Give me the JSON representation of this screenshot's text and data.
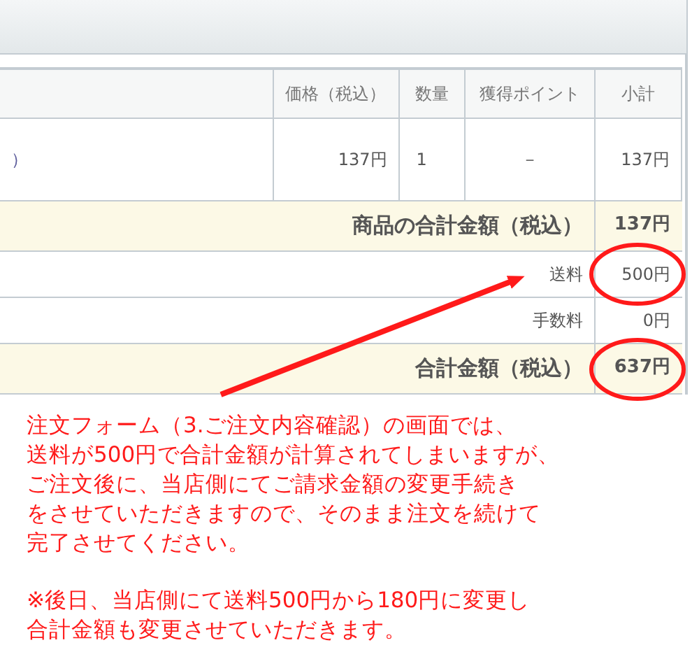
{
  "table": {
    "columns": [
      "",
      "価格（税込）",
      "数量",
      "獲得ポイント",
      "小計"
    ],
    "rows": [
      [
        "）",
        "137円",
        "1",
        "－",
        "137円"
      ]
    ],
    "summary": [
      {
        "kind": "total",
        "label": "商品の合計金額（税込）",
        "value": "137円",
        "circled": false
      },
      {
        "kind": "fee",
        "label": "送料",
        "value": "500円",
        "circled": true
      },
      {
        "kind": "fee",
        "label": "手数料",
        "value": "0円",
        "circled": false
      },
      {
        "kind": "total",
        "label": "合計金額（税込）",
        "value": "637円",
        "circled": true
      }
    ]
  },
  "note": {
    "paragraphs": [
      [
        "注文フォーム（3.ご注文内容確認）の画面では、",
        "送料が500円で合計金額が計算されてしまいますが、",
        "ご注文後に、当店側にてご請求金額の変更手続き",
        "をさせていただきますので、そのまま注文を続けて",
        "完了させてください。"
      ],
      [
        "※後日、当店側にて送料500円から180円に変更し",
        "合計金額も変更させていただきます。"
      ]
    ]
  }
}
